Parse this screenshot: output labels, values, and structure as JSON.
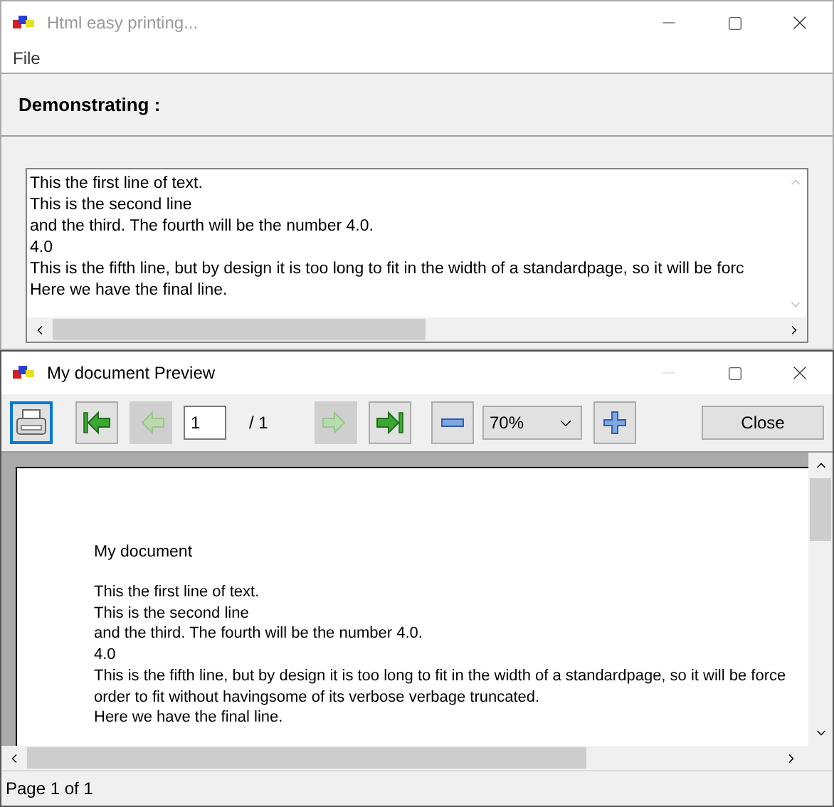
{
  "main_window": {
    "title": "Html easy printing...",
    "menu": [
      "File"
    ],
    "heading": "Demonstrating :",
    "text_lines": [
      "This the first line of text.",
      "This is the second line",
      "and the third. The fourth will be the number 4.0.",
      "4.0",
      "This is the fifth line, but by design it is too long to fit in the width of a standardpage, so it will be forc",
      "Here we have the final line."
    ]
  },
  "preview_window": {
    "title": "My document Preview",
    "minimize_disabled": true,
    "nav_buttons": [
      {
        "kind": "first",
        "disabled": false
      },
      {
        "kind": "prev",
        "disabled": true
      },
      {
        "kind": "next",
        "disabled": true
      },
      {
        "kind": "last",
        "disabled": false
      }
    ],
    "page_field": {
      "value": "1"
    },
    "page_total": "/ 1",
    "zoom": "70%",
    "close_button": "Close",
    "page": {
      "title": "My document",
      "lines": [
        "This the first line of text.",
        "This is the second line",
        "and the third. The fourth will be the number 4.0.",
        "4.0",
        "This is the fifth line, but by design it is too long to fit in the width of a standardpage, so it will be force",
        "order to fit without havingsome of its verbose verbage truncated.",
        "Here we have the final line."
      ]
    },
    "status_bar": "Page 1 of 1"
  }
}
